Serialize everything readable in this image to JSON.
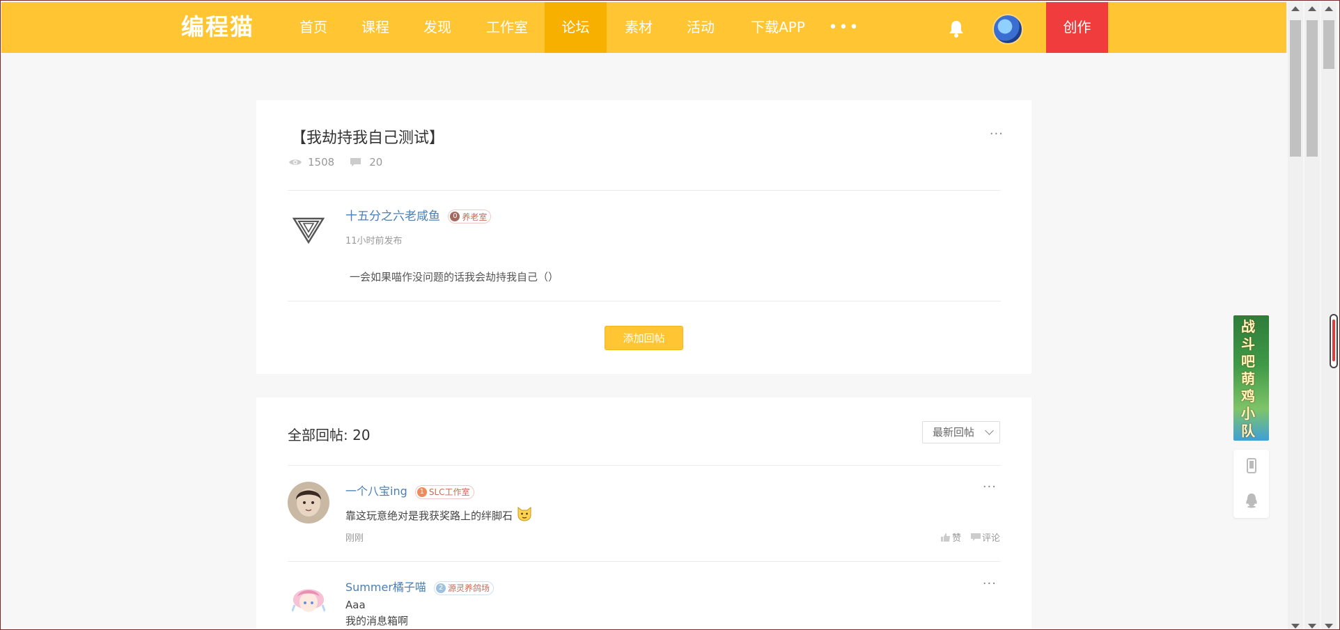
{
  "nav": {
    "logo": "编程猫",
    "items": [
      {
        "label": "首页"
      },
      {
        "label": "课程"
      },
      {
        "label": "发现"
      },
      {
        "label": "工作室"
      },
      {
        "label": "论坛"
      },
      {
        "label": "素材"
      },
      {
        "label": "活动"
      },
      {
        "label": "下载APP"
      }
    ],
    "more": "•••",
    "create": "创作",
    "active_color": "#f7af00",
    "bar_color": "#ffc533"
  },
  "post": {
    "title": "【我劫持我自己测试】",
    "views": "1508",
    "comments": "20",
    "more": "···",
    "author": "十五分之六老咸鱼",
    "badge_level": "0",
    "badge_text": "养老室",
    "time": "11小时前发布",
    "body": "一会如果喵作没问题的话我会劫持我自己（）",
    "reply_button": "添加回帖"
  },
  "replies": {
    "count_label": "全部回帖: 20",
    "sort_label": "最新回帖",
    "items": [
      {
        "name": "一个八宝ing",
        "badge_level": "1",
        "badge_text": "SLC工作室",
        "text": "靠这玩意绝对是我获奖路上的绊脚石",
        "time": "刚刚",
        "like": "赞",
        "comment": "评论",
        "more": "···"
      },
      {
        "name": "Summer橘子喵",
        "badge_level": "2",
        "badge_text": "源灵养鸽场",
        "line1": "Aaa",
        "line2": "我的消息箱啊",
        "more": "···"
      }
    ]
  },
  "side": {
    "promo_text": "战斗吧萌鸡小队"
  }
}
